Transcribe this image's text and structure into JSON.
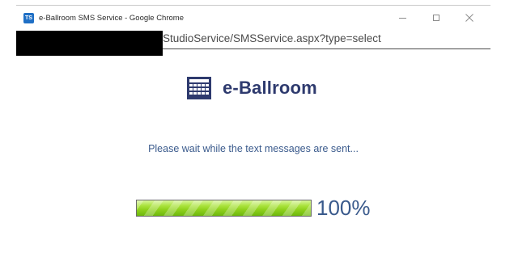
{
  "window": {
    "title": "e-Ballroom SMS Service - Google Chrome",
    "app_icon_text": "TS",
    "controls": [
      "minimize-icon",
      "maximize-icon",
      "close-icon"
    ]
  },
  "address_bar": {
    "url_visible": "StudioService/SMSService.aspx?type=select"
  },
  "brand": {
    "name": "e-Ballroom",
    "logo_icon": "calendar-grid-icon",
    "color": "#2e3a6e"
  },
  "status": {
    "message": "Please wait while the text messages are sent..."
  },
  "progress": {
    "fraction": 1.0,
    "label": "100%",
    "fill_color": "#8fd11c"
  },
  "colors": {
    "accent_text": "#3a5a8c",
    "app_icon": "#1f6fc5"
  }
}
